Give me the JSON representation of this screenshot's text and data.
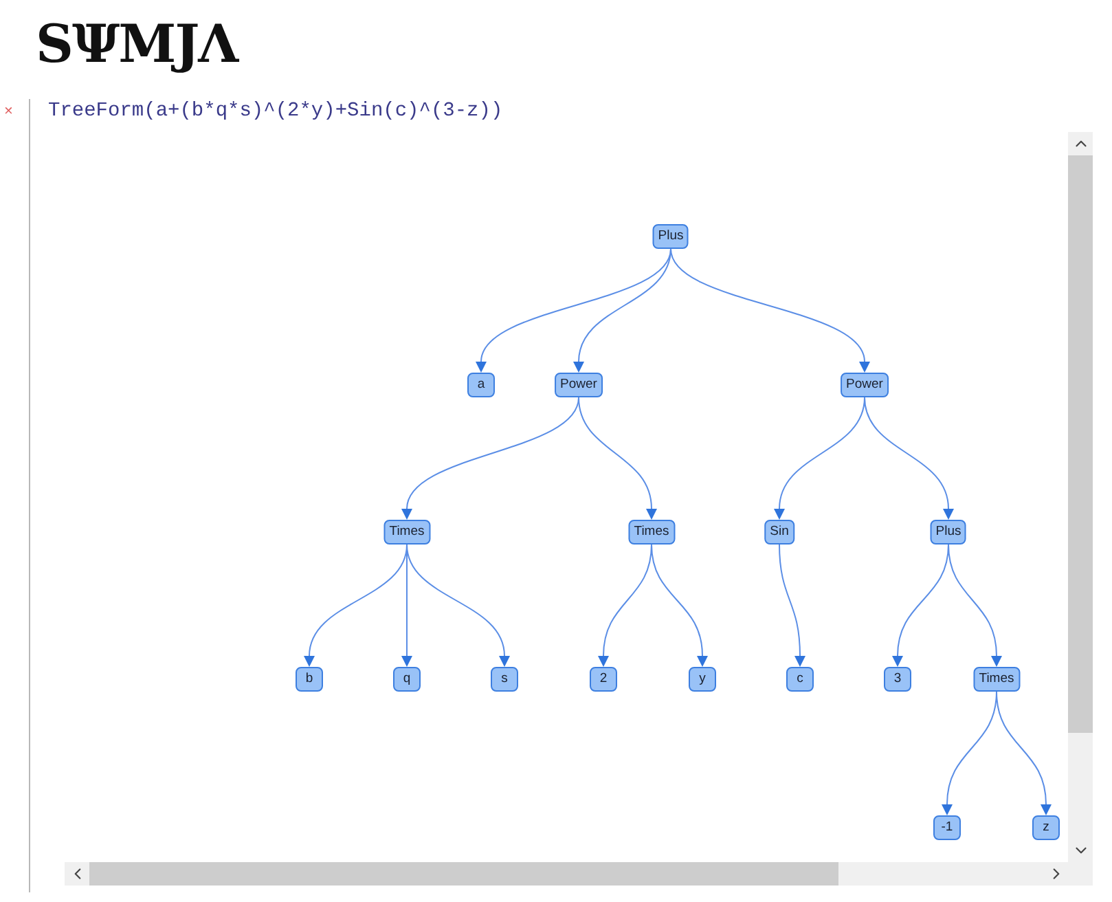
{
  "logo": "SΨMJΛ",
  "cell": {
    "marker": "×",
    "input": "TreeForm(a+(b*q*s)^(2*y)+Sin(c)^(3-z))"
  },
  "tree": {
    "label": "Plus",
    "children": [
      {
        "label": "a"
      },
      {
        "label": "Power",
        "children": [
          {
            "label": "Times",
            "children": [
              {
                "label": "b"
              },
              {
                "label": "q"
              },
              {
                "label": "s"
              }
            ]
          },
          {
            "label": "Times",
            "children": [
              {
                "label": "2"
              },
              {
                "label": "y"
              }
            ]
          }
        ]
      },
      {
        "label": "Power",
        "children": [
          {
            "label": "Sin",
            "children": [
              {
                "label": "c"
              }
            ]
          },
          {
            "label": "Plus",
            "children": [
              {
                "label": "3"
              },
              {
                "label": "Times",
                "children": [
                  {
                    "label": "-1"
                  },
                  {
                    "label": "z"
                  }
                ]
              }
            ]
          }
        ]
      }
    ]
  }
}
